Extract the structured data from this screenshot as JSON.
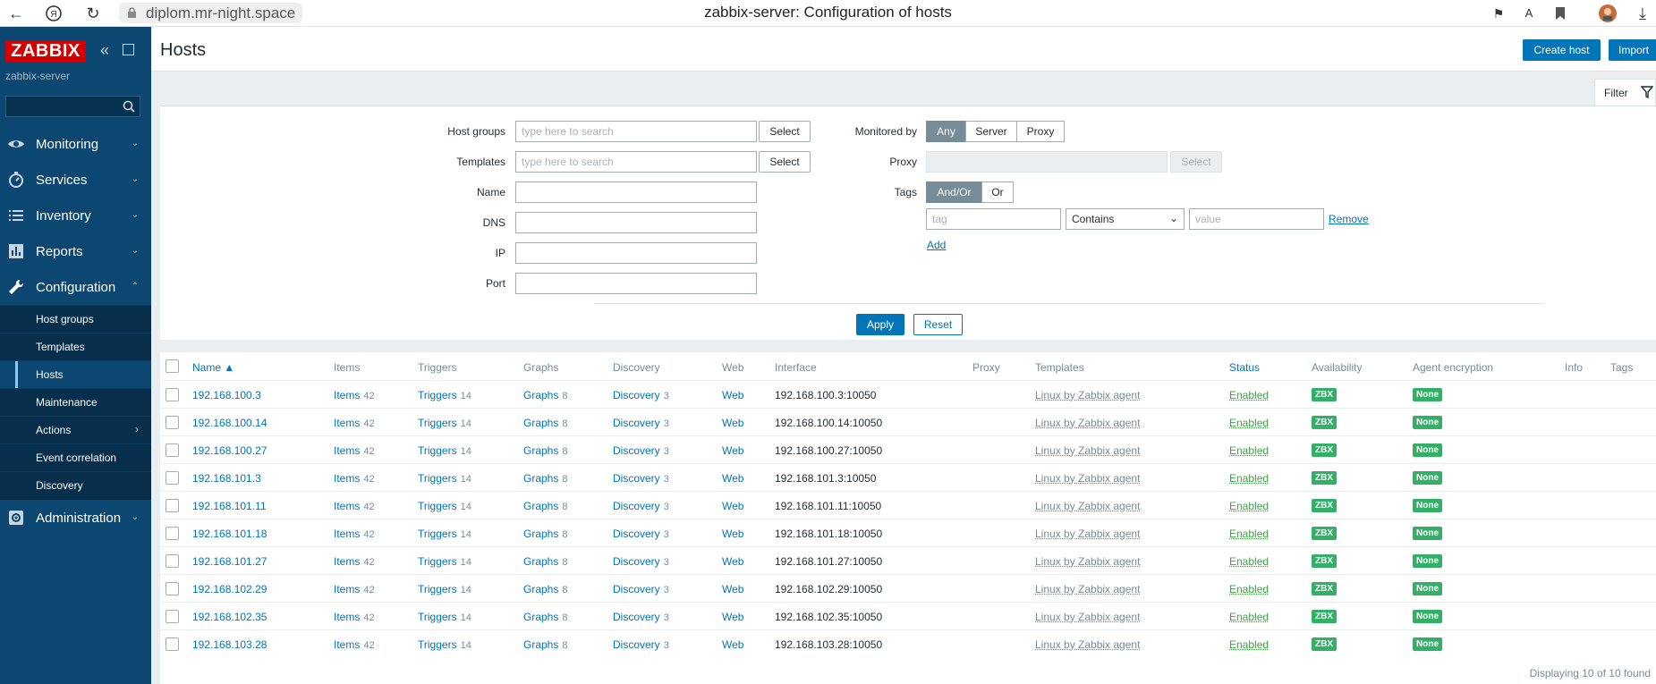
{
  "browser": {
    "url": "diplom.mr-night.space",
    "title": "zabbix-server: Configuration of hosts"
  },
  "sidebar": {
    "logo": "ZABBIX",
    "server_name": "zabbix-server",
    "menu": [
      {
        "label": "Monitoring",
        "icon": "eye-icon"
      },
      {
        "label": "Services",
        "icon": "clock-icon"
      },
      {
        "label": "Inventory",
        "icon": "list-icon"
      },
      {
        "label": "Reports",
        "icon": "bar-chart-icon"
      },
      {
        "label": "Configuration",
        "icon": "wrench-icon",
        "expanded": true
      },
      {
        "label": "Administration",
        "icon": "gear-icon"
      }
    ],
    "submenu": [
      {
        "label": "Host groups"
      },
      {
        "label": "Templates"
      },
      {
        "label": "Hosts",
        "active": true
      },
      {
        "label": "Maintenance"
      },
      {
        "label": "Actions",
        "has_children": true
      },
      {
        "label": "Event correlation"
      },
      {
        "label": "Discovery"
      }
    ]
  },
  "header": {
    "title": "Hosts",
    "create_host": "Create host",
    "import": "Import"
  },
  "filter": {
    "tab_label": "Filter",
    "host_groups_label": "Host groups",
    "templates_label": "Templates",
    "name_label": "Name",
    "dns_label": "DNS",
    "ip_label": "IP",
    "port_label": "Port",
    "search_placeholder": "type here to search",
    "select_label": "Select",
    "monitored_by_label": "Monitored by",
    "monitored_by_options": [
      "Any",
      "Server",
      "Proxy"
    ],
    "proxy_label": "Proxy",
    "tags_label": "Tags",
    "tags_options": [
      "And/Or",
      "Or"
    ],
    "tag_placeholder": "tag",
    "operator": "Contains",
    "value_placeholder": "value",
    "remove_label": "Remove",
    "add_label": "Add",
    "apply_label": "Apply",
    "reset_label": "Reset"
  },
  "table": {
    "columns": [
      "Name ▲",
      "Items",
      "Triggers",
      "Graphs",
      "Discovery",
      "Web",
      "Interface",
      "Proxy",
      "Templates",
      "Status",
      "Availability",
      "Agent encryption",
      "Info",
      "Tags"
    ],
    "rows": [
      {
        "name": "192.168.100.3",
        "items": "Items",
        "items_count": "42",
        "triggers": "Triggers",
        "triggers_count": "14",
        "graphs": "Graphs",
        "graphs_count": "8",
        "discovery": "Discovery",
        "discovery_count": "3",
        "web": "Web",
        "interface": "192.168.100.3:10050",
        "template": "Linux by Zabbix agent",
        "status": "Enabled",
        "availability": "ZBX",
        "encryption": "None"
      },
      {
        "name": "192.168.100.14",
        "items": "Items",
        "items_count": "42",
        "triggers": "Triggers",
        "triggers_count": "14",
        "graphs": "Graphs",
        "graphs_count": "8",
        "discovery": "Discovery",
        "discovery_count": "3",
        "web": "Web",
        "interface": "192.168.100.14:10050",
        "template": "Linux by Zabbix agent",
        "status": "Enabled",
        "availability": "ZBX",
        "encryption": "None"
      },
      {
        "name": "192.168.100.27",
        "items": "Items",
        "items_count": "42",
        "triggers": "Triggers",
        "triggers_count": "14",
        "graphs": "Graphs",
        "graphs_count": "8",
        "discovery": "Discovery",
        "discovery_count": "3",
        "web": "Web",
        "interface": "192.168.100.27:10050",
        "template": "Linux by Zabbix agent",
        "status": "Enabled",
        "availability": "ZBX",
        "encryption": "None"
      },
      {
        "name": "192.168.101.3",
        "items": "Items",
        "items_count": "42",
        "triggers": "Triggers",
        "triggers_count": "14",
        "graphs": "Graphs",
        "graphs_count": "8",
        "discovery": "Discovery",
        "discovery_count": "3",
        "web": "Web",
        "interface": "192.168.101.3:10050",
        "template": "Linux by Zabbix agent",
        "status": "Enabled",
        "availability": "ZBX",
        "encryption": "None"
      },
      {
        "name": "192.168.101.11",
        "items": "Items",
        "items_count": "42",
        "triggers": "Triggers",
        "triggers_count": "14",
        "graphs": "Graphs",
        "graphs_count": "8",
        "discovery": "Discovery",
        "discovery_count": "3",
        "web": "Web",
        "interface": "192.168.101.11:10050",
        "template": "Linux by Zabbix agent",
        "status": "Enabled",
        "availability": "ZBX",
        "encryption": "None"
      },
      {
        "name": "192.168.101.18",
        "items": "Items",
        "items_count": "42",
        "triggers": "Triggers",
        "triggers_count": "14",
        "graphs": "Graphs",
        "graphs_count": "8",
        "discovery": "Discovery",
        "discovery_count": "3",
        "web": "Web",
        "interface": "192.168.101.18:10050",
        "template": "Linux by Zabbix agent",
        "status": "Enabled",
        "availability": "ZBX",
        "encryption": "None"
      },
      {
        "name": "192.168.101.27",
        "items": "Items",
        "items_count": "42",
        "triggers": "Triggers",
        "triggers_count": "14",
        "graphs": "Graphs",
        "graphs_count": "8",
        "discovery": "Discovery",
        "discovery_count": "3",
        "web": "Web",
        "interface": "192.168.101.27:10050",
        "template": "Linux by Zabbix agent",
        "status": "Enabled",
        "availability": "ZBX",
        "encryption": "None"
      },
      {
        "name": "192.168.102.29",
        "items": "Items",
        "items_count": "42",
        "triggers": "Triggers",
        "triggers_count": "14",
        "graphs": "Graphs",
        "graphs_count": "8",
        "discovery": "Discovery",
        "discovery_count": "3",
        "web": "Web",
        "interface": "192.168.102.29:10050",
        "template": "Linux by Zabbix agent",
        "status": "Enabled",
        "availability": "ZBX",
        "encryption": "None"
      },
      {
        "name": "192.168.102.35",
        "items": "Items",
        "items_count": "42",
        "triggers": "Triggers",
        "triggers_count": "14",
        "graphs": "Graphs",
        "graphs_count": "8",
        "discovery": "Discovery",
        "discovery_count": "3",
        "web": "Web",
        "interface": "192.168.102.35:10050",
        "template": "Linux by Zabbix agent",
        "status": "Enabled",
        "availability": "ZBX",
        "encryption": "None"
      },
      {
        "name": "192.168.103.28",
        "items": "Items",
        "items_count": "42",
        "triggers": "Triggers",
        "triggers_count": "14",
        "graphs": "Graphs",
        "graphs_count": "8",
        "discovery": "Discovery",
        "discovery_count": "3",
        "web": "Web",
        "interface": "192.168.103.28:10050",
        "template": "Linux by Zabbix agent",
        "status": "Enabled",
        "availability": "ZBX",
        "encryption": "None"
      }
    ],
    "footer": "Displaying 10 of 10 found"
  },
  "colors": {
    "sidebar_bg": "#0b4771",
    "logo_bg": "#d40000",
    "primary": "#0275b8",
    "status_green": "#429e47",
    "badge_green": "#34af67"
  }
}
